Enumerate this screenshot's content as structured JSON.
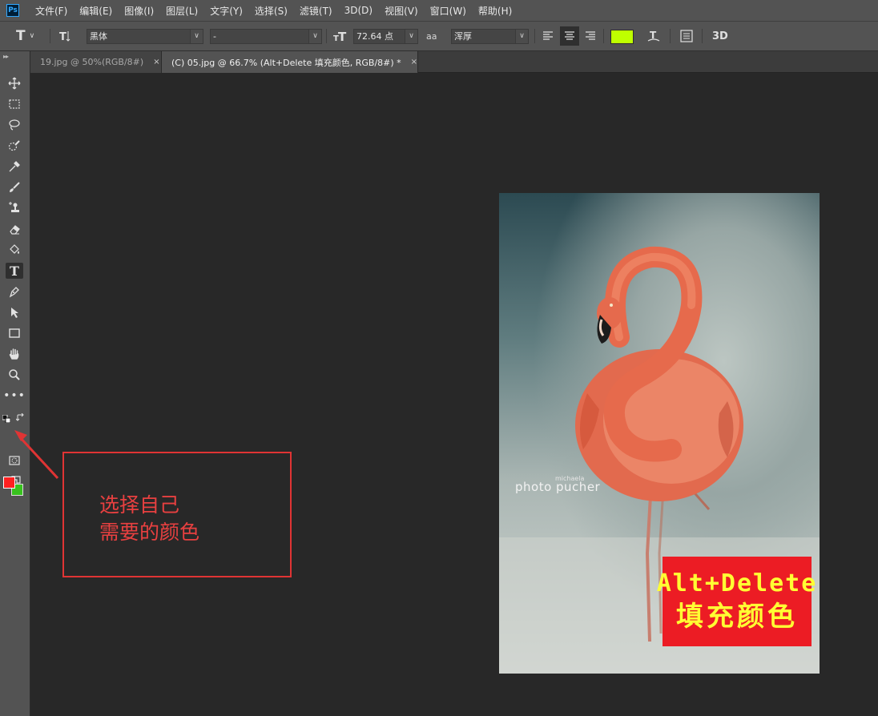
{
  "app": {
    "logo": "Ps"
  },
  "menu": [
    "文件(F)",
    "编辑(E)",
    "图像(I)",
    "图层(L)",
    "文字(Y)",
    "选择(S)",
    "滤镜(T)",
    "3D(D)",
    "视图(V)",
    "窗口(W)",
    "帮助(H)"
  ],
  "options": {
    "tool_icon": "T",
    "font_family": "黑体",
    "font_style": "-",
    "font_size": "72.64 点",
    "antialias_icon": "aa",
    "antialias": "浑厚",
    "text_color": "#bfff00",
    "threed_label": "3D"
  },
  "tabs": [
    {
      "label": "19.jpg @ 50%(RGB/8#)",
      "close": "×"
    },
    {
      "label": "(C) 05.jpg @ 66.7% (Alt+Delete 填充颜色, RGB/8#) *",
      "close": "×"
    }
  ],
  "colors": {
    "foreground": "#ff2020",
    "background": "#38c21e"
  },
  "document": {
    "watermark_small": "michaela",
    "watermark": "photo pucher",
    "fill_line1": "Alt+Delete",
    "fill_line2": "填充颜色"
  },
  "annotation": {
    "line1": "选择自己",
    "line2": "需要的颜色"
  },
  "icons": [
    "move-icon",
    "marquee-icon",
    "lasso-icon",
    "quick-select-icon",
    "eyedropper-icon",
    "brush-icon",
    "stamp-icon",
    "eraser-icon",
    "paint-bucket-icon",
    "type-icon",
    "pen-icon",
    "path-select-icon",
    "rectangle-icon",
    "hand-icon",
    "zoom-icon",
    "more-icon",
    "quick-mask-icon",
    "screen-mode-icon"
  ]
}
